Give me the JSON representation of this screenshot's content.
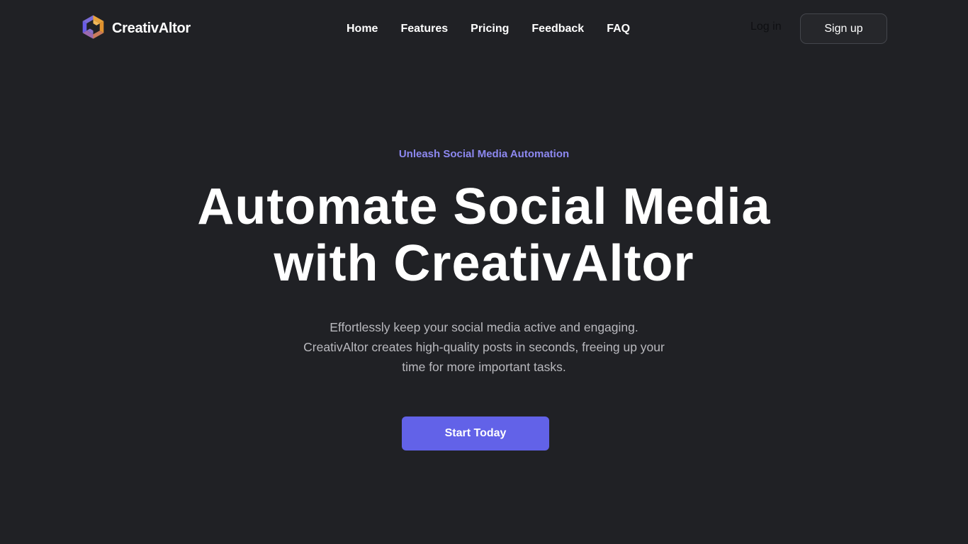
{
  "brand": {
    "name": "CreativAltor",
    "logo_icon": "hexagon-swirl-logo-icon",
    "logo_colors": [
      "#6a5de8",
      "#e8a23a",
      "#b86a8a"
    ]
  },
  "nav": {
    "items": [
      {
        "label": "Home"
      },
      {
        "label": "Features"
      },
      {
        "label": "Pricing"
      },
      {
        "label": "Feedback"
      },
      {
        "label": "FAQ"
      }
    ],
    "login_label": "Log in",
    "signup_label": "Sign up"
  },
  "hero": {
    "eyebrow": "Unleash Social Media Automation",
    "title_line1": "Automate Social Media",
    "title_line2": "with CreativAltor",
    "description": "Effortlessly keep your social media active and engaging. CreativAltor creates high-quality posts in seconds, freeing up your time for more important tasks.",
    "cta_label": "Start Today"
  },
  "colors": {
    "background": "#202125",
    "accent": "#6262e8",
    "eyebrow": "#8d88f0",
    "body_text": "#b9b9be"
  }
}
